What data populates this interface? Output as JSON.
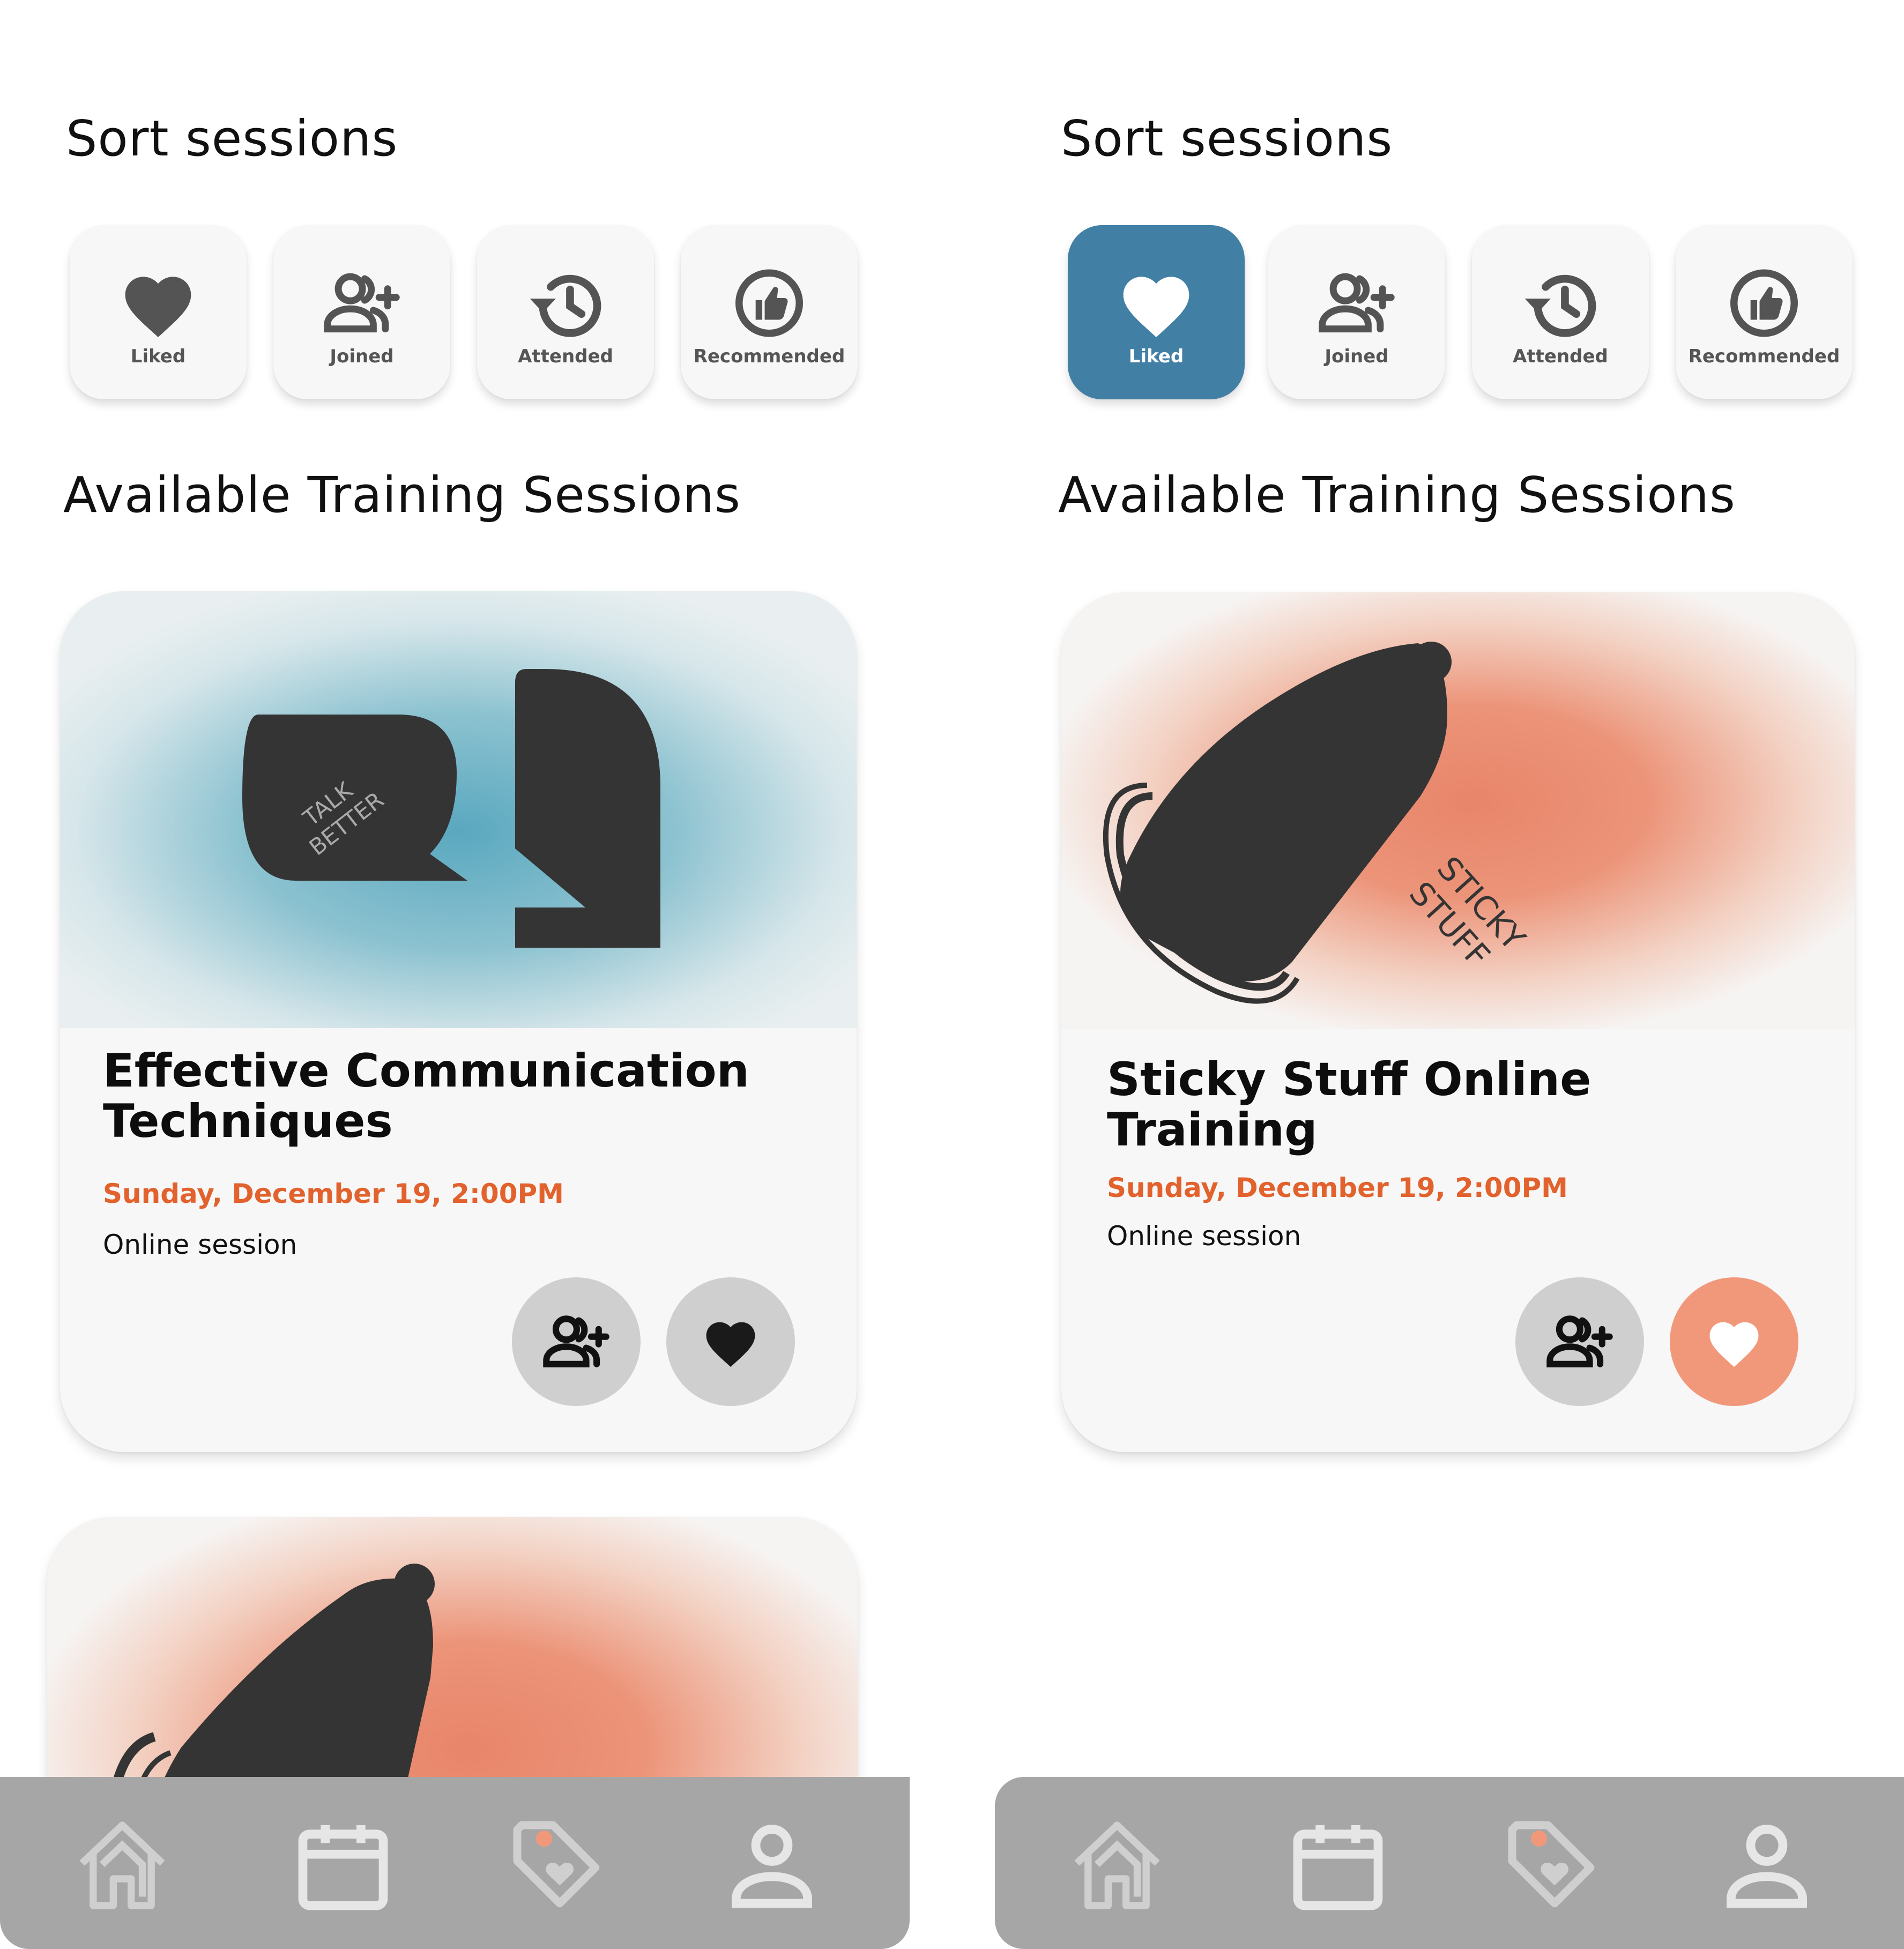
{
  "colors": {
    "accent_blue": "#417fa5",
    "date_orange": "#e2622e",
    "liked_salmon": "#f2987a",
    "button_gray": "#cfcfcf",
    "nav_gray": "#a6a6a6",
    "nav_dot": "#f2987a"
  },
  "left": {
    "sort_title": "Sort sessions",
    "sort_buttons": [
      {
        "label": "Liked",
        "icon": "heart-icon",
        "active": false
      },
      {
        "label": "Joined",
        "icon": "add-user-icon",
        "active": false
      },
      {
        "label": "Attended",
        "icon": "history-icon",
        "active": false
      },
      {
        "label": "Recommended",
        "icon": "thumbs-up-icon",
        "active": false
      }
    ],
    "available_title": "Available Training Sessions",
    "cards": [
      {
        "art": "talk-better-illustration",
        "art_text": [
          "TALK",
          "BETTER"
        ],
        "title_line1": "Effective Communication",
        "title_line2": "Techniques",
        "date": "Sunday, December 19, 2:00PM",
        "location": "Online session",
        "liked": false
      },
      {
        "art": "sticky-stuff-illustration",
        "partial": true
      }
    ],
    "nav": [
      "home-icon",
      "calendar-icon",
      "tag-heart-icon",
      "profile-icon"
    ]
  },
  "right": {
    "sort_title": "Sort sessions",
    "sort_buttons": [
      {
        "label": "Liked",
        "icon": "heart-icon",
        "active": true
      },
      {
        "label": "Joined",
        "icon": "add-user-icon",
        "active": false
      },
      {
        "label": "Attended",
        "icon": "history-icon",
        "active": false
      },
      {
        "label": "Recommended",
        "icon": "thumbs-up-icon",
        "active": false
      }
    ],
    "available_title": "Available Training Sessions",
    "cards": [
      {
        "art": "sticky-stuff-illustration",
        "art_text": [
          "STICKY",
          "STUFF"
        ],
        "title_line1": "Sticky Stuff Online",
        "title_line2": "Training",
        "date": "Sunday, December 19, 2:00PM",
        "location": "Online session",
        "liked": true
      }
    ],
    "nav": [
      "home-icon",
      "calendar-icon",
      "tag-heart-icon",
      "profile-icon"
    ]
  }
}
